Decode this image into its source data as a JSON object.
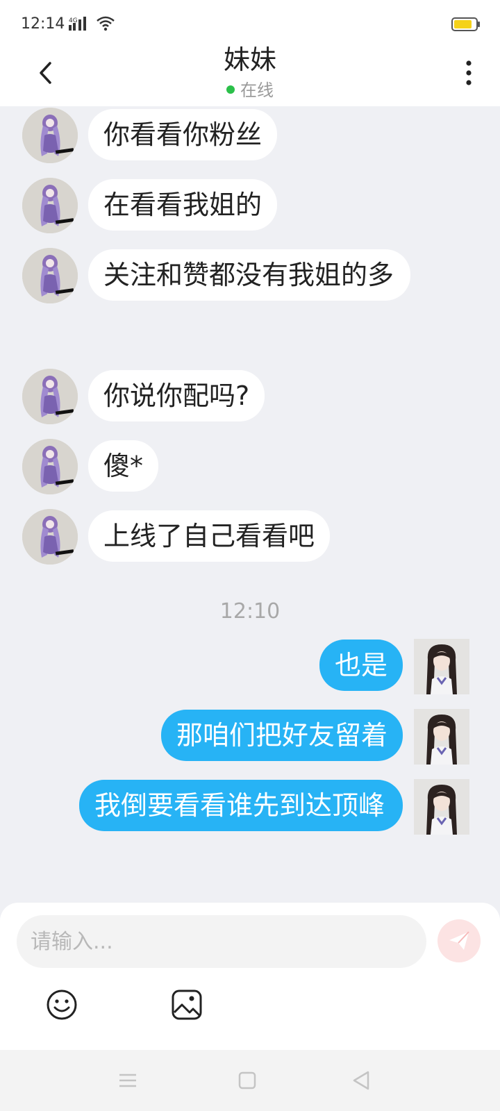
{
  "status_bar": {
    "time": "12:14",
    "network": "4G"
  },
  "header": {
    "title": "妹妹",
    "presence": "在线",
    "presence_color": "#2bc04a"
  },
  "messages": [
    {
      "side": "in",
      "text": "你看看你粉丝"
    },
    {
      "side": "in",
      "text": "在看看我姐的"
    },
    {
      "side": "in",
      "text": "关注和赞都没有我姐的多"
    },
    {
      "side": "in",
      "text": "你说你配吗?"
    },
    {
      "side": "in",
      "text": "傻*"
    },
    {
      "side": "in",
      "text": "上线了自己看看吧"
    },
    {
      "side": "divider",
      "text": "12:10"
    },
    {
      "side": "out",
      "text": "也是"
    },
    {
      "side": "out",
      "text": "那咱们把好友留着"
    },
    {
      "side": "out",
      "text": "我倒要看看谁先到达顶峰"
    }
  ],
  "input": {
    "placeholder": "请输入..."
  },
  "colors": {
    "outgoing_bubble": "#27b3f5",
    "incoming_bubble": "#ffffff",
    "background": "#eff0f4"
  },
  "icons": {
    "back": "back-arrow-icon",
    "more": "more-vertical-icon",
    "send": "send-icon",
    "emoji": "emoji-icon",
    "image": "image-icon"
  }
}
